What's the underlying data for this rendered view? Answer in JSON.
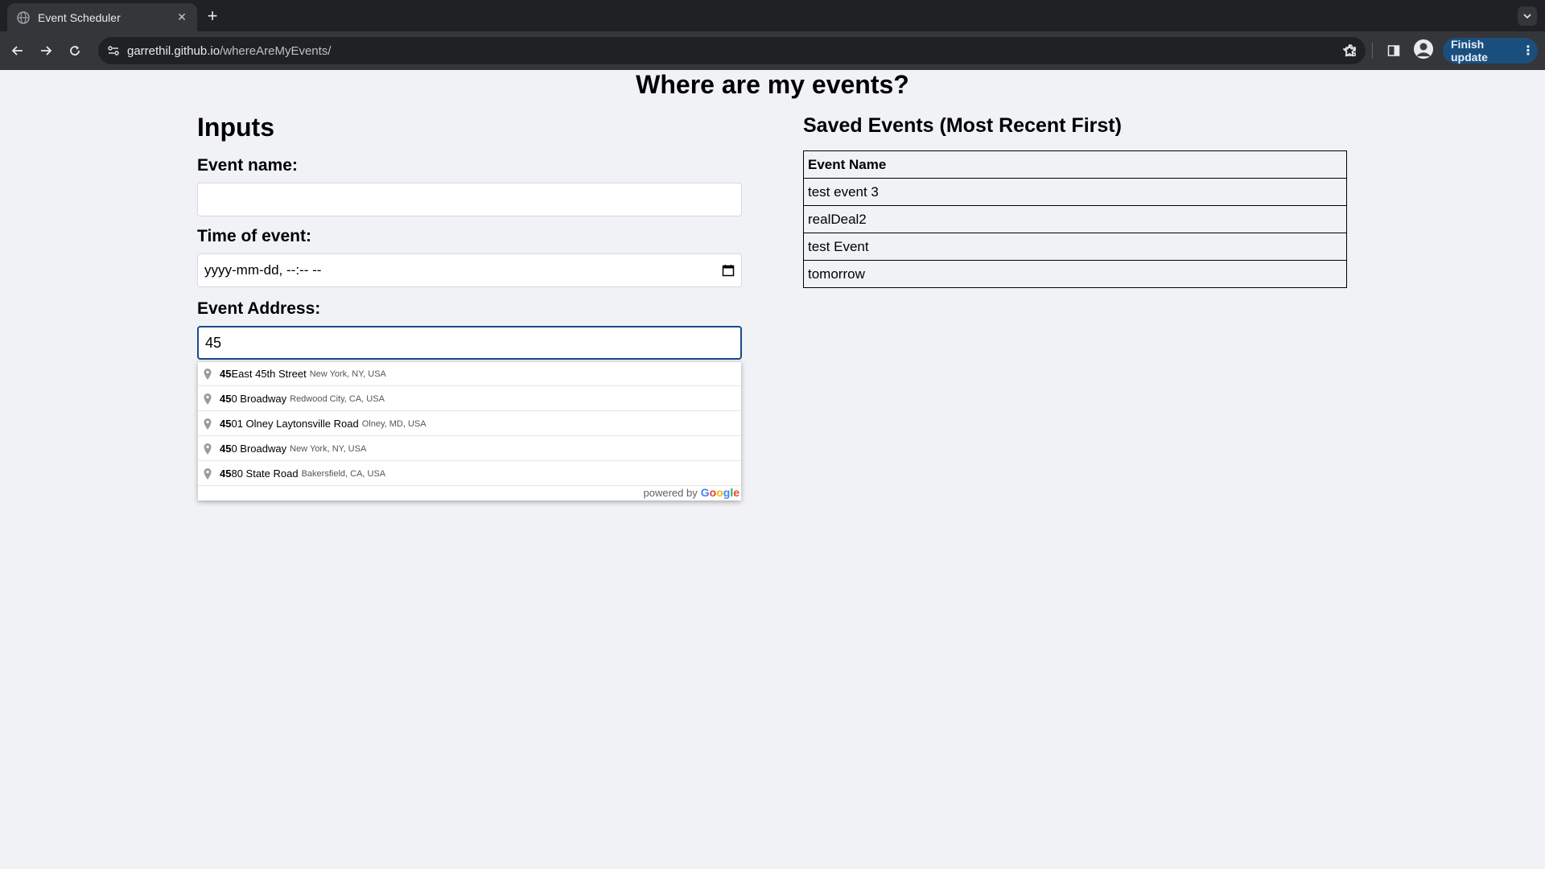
{
  "browser": {
    "tab_title": "Event Scheduler",
    "tab_close": "✕",
    "new_tab": "+",
    "url_host": "garrethil.github.io",
    "url_path": "/whereAreMyEvents/",
    "finish_update_label": "Finish update",
    "menu_glyph": "⋮"
  },
  "page": {
    "title": "Where are my events?",
    "inputs_heading": "Inputs",
    "event_name_label": "Event name:",
    "event_name_value": "",
    "time_label": "Time of event:",
    "time_placeholder": "yyyy-mm-dd, --:-- --",
    "address_label": "Event Address:",
    "address_value": "45"
  },
  "suggestions": {
    "items": [
      {
        "match": "45",
        "rest": " East 45th Street",
        "secondary": "New York, NY, USA"
      },
      {
        "match": "45",
        "rest": "0 Broadway",
        "secondary": "Redwood City, CA, USA"
      },
      {
        "match": "45",
        "rest": "01 Olney Laytonsville Road",
        "secondary": "Olney, MD, USA"
      },
      {
        "match": "45",
        "rest": "0 Broadway",
        "secondary": "New York, NY, USA"
      },
      {
        "match": "45",
        "rest": "80 State Road",
        "secondary": "Bakersfield, CA, USA"
      }
    ],
    "powered_by": "powered by",
    "google": {
      "G": "G",
      "o1": "o",
      "o2": "o",
      "g": "g",
      "l": "l",
      "e": "e"
    }
  },
  "saved": {
    "heading": "Saved Events (Most Recent First)",
    "column": "Event Name",
    "rows": [
      "test event 3",
      "realDeal2",
      "test Event",
      "tomorrow"
    ]
  },
  "colors": {
    "chrome_dark": "#202124",
    "chrome_toolbar": "#35363a",
    "page_bg": "#f0f2f5",
    "focus_border": "#1a4a8c",
    "update_button": "#1a4f7d"
  },
  "icons": [
    "globe-icon",
    "close-icon",
    "plus-icon",
    "back-icon",
    "forward-icon",
    "reload-icon",
    "site-info-icon",
    "star-icon",
    "extensions-icon",
    "side-panel-icon",
    "avatar",
    "calendar-icon",
    "map-pin-icon"
  ]
}
